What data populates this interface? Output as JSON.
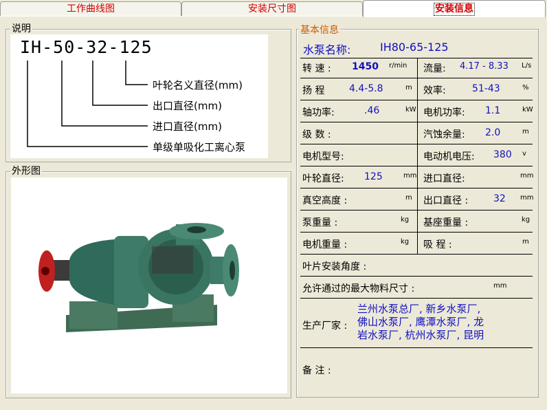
{
  "tabs": [
    "工作曲线图",
    "安装尺寸图",
    "安装信息"
  ],
  "left": {
    "legend_desc": "说明",
    "model_code": "IH-50-32-125",
    "labels": [
      "叶轮名义直径(mm)",
      "出口直径(mm)",
      "进口直径(mm)",
      "单级单吸化工离心泵"
    ],
    "legend_shape": "外形图",
    "photo_desc": "pump-photo"
  },
  "info": {
    "title": "基本信息",
    "pump_name_label": "水泵名称:",
    "pump_name_value": "IH80-65-125",
    "speed_label": "转  速 :",
    "speed_value": "1450",
    "speed_unit": "r/min",
    "flow_label": "流量:",
    "flow_value": "4.17 - 8.33",
    "flow_unit": "L/s",
    "head_label": "扬  程",
    "head_value": "4.4-5.8",
    "head_unit": "m",
    "eff_label": "效率:",
    "eff_value": "51-43",
    "eff_unit": "%",
    "shaft_label": "轴功率:",
    "shaft_value": ".46",
    "shaft_unit": "kW",
    "motor_power_label": "电机功率:",
    "motor_power_value": "1.1",
    "motor_power_unit": "kW",
    "stages_label": "级  数 :",
    "npsh_label": "汽蚀余量:",
    "npsh_value": "2.0",
    "npsh_unit": "m",
    "motor_model_label": "电机型号:",
    "voltage_label": "电动机电压:",
    "voltage_value": "380",
    "voltage_unit": "v",
    "impeller_label": "叶轮直径:",
    "impeller_value": "125",
    "impeller_unit": "mm",
    "inlet_label": "进口直径:",
    "inlet_unit": "mm",
    "vacuum_label": "真空高度 :",
    "vacuum_unit": "m",
    "outlet_label": "出口直径 :",
    "outlet_value": "32",
    "outlet_unit": "mm",
    "pump_weight_label": "泵重量 :",
    "pump_weight_unit": "kg",
    "base_weight_label": "基座重量 :",
    "base_weight_unit": "kg",
    "motor_weight_label": "电机重量 :",
    "motor_weight_unit": "kg",
    "suction_label": "吸  程 :",
    "suction_unit": "m",
    "blade_angle_label": "叶片安装角度 :",
    "max_size_label": "允许通过的最大物料尺寸 :",
    "max_size_unit": "mm",
    "maker_label": "生产厂家 :",
    "maker_lines": [
      "兰州水泵总厂, 新乡水泵厂,",
      "佛山水泵厂, 鹰潭水泵厂, 龙",
      "岩水泵厂, 杭州水泵厂, 昆明"
    ],
    "remark_label": "备  注 :"
  },
  "colors": {
    "tab_text": "#d00000",
    "title_orange": "#d05a00",
    "value_blue": "#1010c0"
  }
}
